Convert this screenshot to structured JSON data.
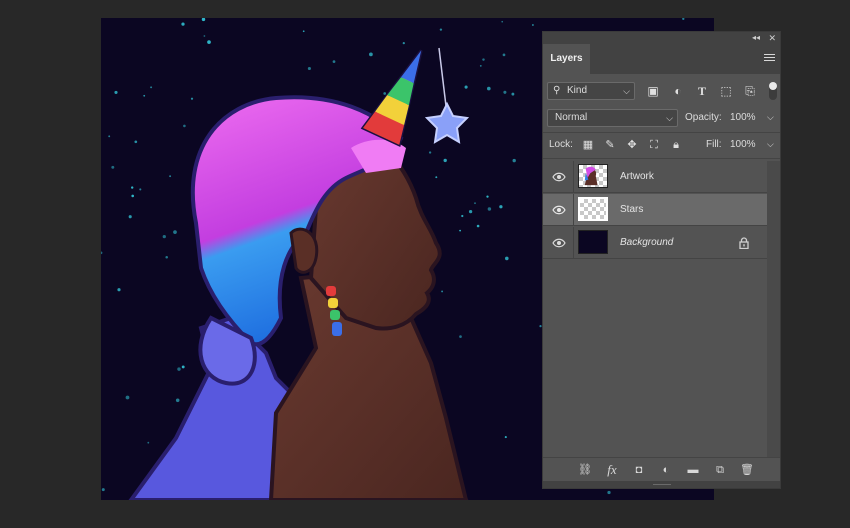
{
  "panel": {
    "tab_label": "Layers",
    "collapse_glyph": "◂◂",
    "close_glyph": "✕",
    "filter": {
      "kind_label": "Kind",
      "kind_icon": "search-icon",
      "icons": [
        "image-filter-icon",
        "adjustment-filter-icon",
        "type-filter-icon",
        "shape-filter-icon",
        "smart-object-filter-icon"
      ]
    },
    "blend_mode": "Normal",
    "opacity_label": "Opacity:",
    "opacity_value": "100%",
    "lock_label": "Lock:",
    "lock_icons": [
      "lock-transparent-pixels-icon",
      "lock-image-pixels-icon",
      "lock-position-icon",
      "lock-artboard-icon",
      "lock-all-icon"
    ],
    "fill_label": "Fill:",
    "fill_value": "100%",
    "layers": [
      {
        "name": "Artwork",
        "visible": true,
        "selected": false,
        "locked": false
      },
      {
        "name": "Stars",
        "visible": true,
        "selected": true,
        "locked": false
      },
      {
        "name": "Background",
        "visible": true,
        "selected": false,
        "locked": true
      }
    ],
    "bottom_icons": [
      "link-layers-icon",
      "fx-icon",
      "add-mask-icon",
      "new-adjustment-layer-icon",
      "new-group-icon",
      "new-layer-icon",
      "delete-layer-icon"
    ],
    "bottom_glyphs": [
      "⛓",
      "fx",
      "◘",
      "◐",
      "▬",
      "⧉",
      "🗑"
    ]
  },
  "colors": {
    "panel_bg": "#535353",
    "panel_dark": "#424242",
    "selected_row": "#6a6a6a",
    "canvas_bg": "#0b0622",
    "app_bg": "#282828",
    "hair_pink": "#e25ae8",
    "hair_blue": "#2f8fe8",
    "skin": "#5a3028",
    "dress": "#5b5be0",
    "star_dot": "#2fb6c8"
  }
}
